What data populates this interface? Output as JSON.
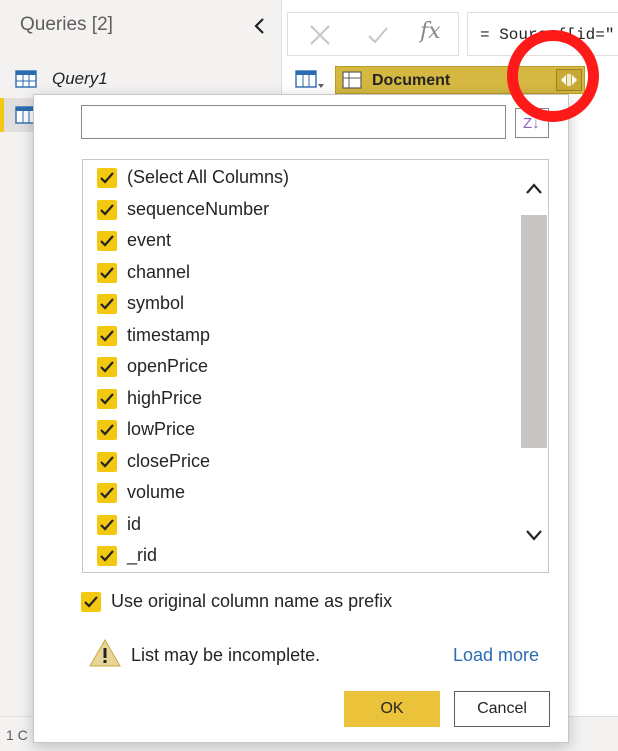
{
  "queries_pane": {
    "title": "Queries [2]",
    "items": [
      {
        "label": "Query1",
        "icon": "table-icon"
      },
      {
        "label": "",
        "icon": "table-icon"
      }
    ]
  },
  "formula_bar": {
    "cancel_icon": "close-icon",
    "commit_icon": "check-icon",
    "fx_label": "fx",
    "formula": "= Source{[id=\""
  },
  "grid": {
    "column_header": "Document",
    "column_type_icon": "table-icon",
    "expand_icon": "expand-columns-icon"
  },
  "popup": {
    "search": {
      "value": "",
      "placeholder": ""
    },
    "sort_label": "Z↓",
    "columns": [
      {
        "label": "(Select All Columns)",
        "checked": true
      },
      {
        "label": "sequenceNumber",
        "checked": true
      },
      {
        "label": "event",
        "checked": true
      },
      {
        "label": "channel",
        "checked": true
      },
      {
        "label": "symbol",
        "checked": true
      },
      {
        "label": "timestamp",
        "checked": true
      },
      {
        "label": "openPrice",
        "checked": true
      },
      {
        "label": "highPrice",
        "checked": true
      },
      {
        "label": "lowPrice",
        "checked": true
      },
      {
        "label": "closePrice",
        "checked": true
      },
      {
        "label": "volume",
        "checked": true
      },
      {
        "label": "id",
        "checked": true
      },
      {
        "label": "_rid",
        "checked": true
      }
    ],
    "prefix_option": {
      "label": "Use original column name as prefix",
      "checked": true
    },
    "warning_text": "List may be incomplete.",
    "load_more_label": "Load more",
    "ok_label": "OK",
    "cancel_label": "Cancel"
  },
  "status_bar": {
    "text": "1 C"
  },
  "colors": {
    "accent": "#f2c811",
    "header_fill": "#d4b841",
    "annotation": "#ff1a1a",
    "link": "#2b6cb0"
  }
}
